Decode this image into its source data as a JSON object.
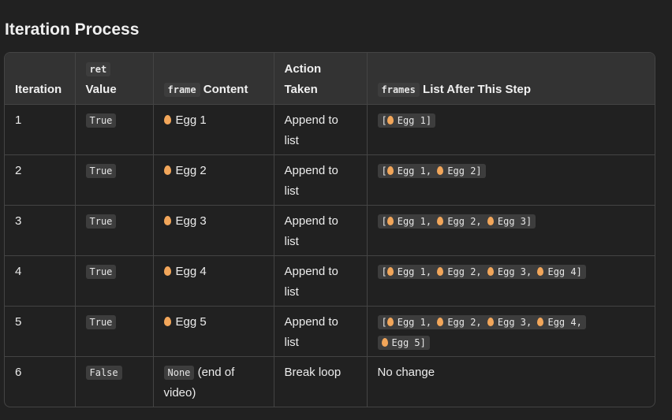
{
  "title": "Iteration Process",
  "header": {
    "iteration": "Iteration",
    "ret_code": "ret",
    "ret_label": "Value",
    "frame_code": "frame",
    "frame_label": "Content",
    "action_line1": "Action",
    "action_line2": "Taken",
    "frames_code": "frames",
    "frames_label": "List After This Step"
  },
  "rows": [
    {
      "iteration": "1",
      "ret": "True",
      "content": "Egg 1",
      "action_line1": "Append to",
      "action_line2": "list",
      "list_line1": "[ Egg 1]"
    },
    {
      "iteration": "2",
      "ret": "True",
      "content": "Egg 2",
      "action_line1": "Append to",
      "action_line2": "list",
      "list_line1": "[ Egg 1,  Egg 2]"
    },
    {
      "iteration": "3",
      "ret": "True",
      "content": "Egg 3",
      "action_line1": "Append to",
      "action_line2": "list",
      "list_line1": "[ Egg 1,  Egg 2,  Egg 3]"
    },
    {
      "iteration": "4",
      "ret": "True",
      "content": "Egg 4",
      "action_line1": "Append to",
      "action_line2": "list",
      "list_line1": "[ Egg 1,  Egg 2,  Egg 3,  Egg 4]"
    },
    {
      "iteration": "5",
      "ret": "True",
      "content": "Egg 5",
      "action_line1": "Append to",
      "action_line2": "list",
      "list_line1": "[ Egg 1,  Egg 2,  Egg 3,  Egg 4,",
      "list_line2": " Egg 5]"
    },
    {
      "iteration": "6",
      "ret": "False",
      "content_code": "None",
      "content_after": " (end of",
      "content_line2": "video)",
      "action_line1": "Break loop",
      "list_text": "No change"
    }
  ],
  "icons": {
    "egg": "egg-icon"
  },
  "colors": {
    "background": "#212121",
    "header": "#333333",
    "code_bg": "#3d3d3d",
    "egg": "#f2a65a"
  }
}
